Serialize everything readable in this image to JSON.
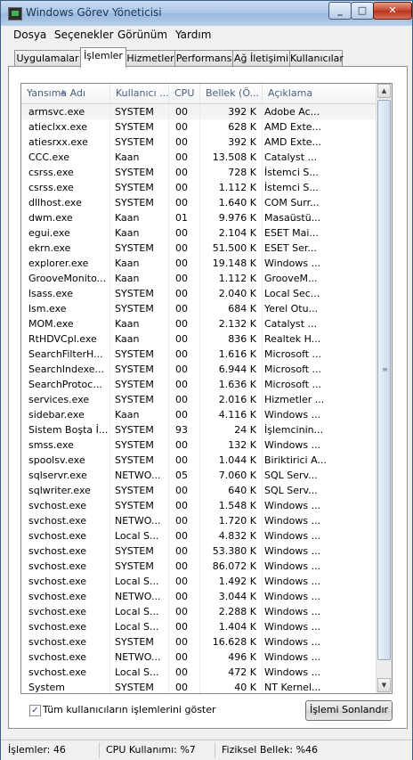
{
  "window": {
    "title": "Windows Görev Yöneticisi"
  },
  "menu": [
    "Dosya",
    "Seçenekler",
    "Görünüm",
    "Yardım"
  ],
  "tabs": [
    "Uygulamalar",
    "İşlemler",
    "Hizmetler",
    "Performans",
    "Ağ İletişimi",
    "Kullanıcılar"
  ],
  "active_tab": "İşlemler",
  "columns": [
    "Yansıma Adı",
    "Kullanıcı ...",
    "CPU",
    "Bellek (Ö...",
    "Açıklama"
  ],
  "processes": [
    [
      "armsvc.exe",
      "SYSTEM",
      "00",
      "392 K",
      "Adobe Ac..."
    ],
    [
      "atieclxx.exe",
      "SYSTEM",
      "00",
      "628 K",
      "AMD Exte..."
    ],
    [
      "atiesrxx.exe",
      "SYSTEM",
      "00",
      "392 K",
      "AMD Exte..."
    ],
    [
      "CCC.exe",
      "Kaan",
      "00",
      "13.508 K",
      "Catalyst ..."
    ],
    [
      "csrss.exe",
      "SYSTEM",
      "00",
      "728 K",
      "İstemci S..."
    ],
    [
      "csrss.exe",
      "SYSTEM",
      "00",
      "1.112 K",
      "İstemci S..."
    ],
    [
      "dllhost.exe",
      "SYSTEM",
      "00",
      "1.640 K",
      "COM Surr..."
    ],
    [
      "dwm.exe",
      "Kaan",
      "01",
      "9.976 K",
      "Masaüstü..."
    ],
    [
      "egui.exe",
      "Kaan",
      "00",
      "2.104 K",
      "ESET Mai..."
    ],
    [
      "ekrn.exe",
      "SYSTEM",
      "00",
      "51.500 K",
      "ESET Ser..."
    ],
    [
      "explorer.exe",
      "Kaan",
      "00",
      "19.148 K",
      "Windows ..."
    ],
    [
      "GrooveMonito...",
      "Kaan",
      "00",
      "1.112 K",
      "GrooveM..."
    ],
    [
      "lsass.exe",
      "SYSTEM",
      "00",
      "2.040 K",
      "Local Sec..."
    ],
    [
      "lsm.exe",
      "SYSTEM",
      "00",
      "684 K",
      "Yerel Otu..."
    ],
    [
      "MOM.exe",
      "Kaan",
      "00",
      "2.132 K",
      "Catalyst ..."
    ],
    [
      "RtHDVCpl.exe",
      "Kaan",
      "00",
      "836 K",
      "Realtek H..."
    ],
    [
      "SearchFilterH...",
      "SYSTEM",
      "00",
      "1.616 K",
      "Microsoft ..."
    ],
    [
      "SearchIndexe...",
      "SYSTEM",
      "00",
      "6.944 K",
      "Microsoft ..."
    ],
    [
      "SearchProtoc...",
      "SYSTEM",
      "00",
      "1.636 K",
      "Microsoft ..."
    ],
    [
      "services.exe",
      "SYSTEM",
      "00",
      "2.016 K",
      "Hizmetler ..."
    ],
    [
      "sidebar.exe",
      "Kaan",
      "00",
      "4.116 K",
      "Windows ..."
    ],
    [
      "Sistem Boşta İ...",
      "SYSTEM",
      "93",
      "24 K",
      "İşlemcinin..."
    ],
    [
      "smss.exe",
      "SYSTEM",
      "00",
      "132 K",
      "Windows ..."
    ],
    [
      "spoolsv.exe",
      "SYSTEM",
      "00",
      "1.044 K",
      "Biriktirici A..."
    ],
    [
      "sqlservr.exe",
      "NETWO...",
      "05",
      "7.060 K",
      "SQL Serv..."
    ],
    [
      "sqlwriter.exe",
      "SYSTEM",
      "00",
      "640 K",
      "SQL Serv..."
    ],
    [
      "svchost.exe",
      "SYSTEM",
      "00",
      "1.548 K",
      "Windows ..."
    ],
    [
      "svchost.exe",
      "NETWO...",
      "00",
      "1.720 K",
      "Windows ..."
    ],
    [
      "svchost.exe",
      "Local S...",
      "00",
      "4.832 K",
      "Windows ..."
    ],
    [
      "svchost.exe",
      "SYSTEM",
      "00",
      "53.380 K",
      "Windows ..."
    ],
    [
      "svchost.exe",
      "SYSTEM",
      "00",
      "86.072 K",
      "Windows ..."
    ],
    [
      "svchost.exe",
      "Local S...",
      "00",
      "1.492 K",
      "Windows ..."
    ],
    [
      "svchost.exe",
      "NETWO...",
      "00",
      "3.044 K",
      "Windows ..."
    ],
    [
      "svchost.exe",
      "Local S...",
      "00",
      "2.288 K",
      "Windows ..."
    ],
    [
      "svchost.exe",
      "Local S...",
      "00",
      "1.404 K",
      "Windows ..."
    ],
    [
      "svchost.exe",
      "SYSTEM",
      "00",
      "16.628 K",
      "Windows ..."
    ],
    [
      "svchost.exe",
      "NETWO...",
      "00",
      "496 K",
      "Windows ..."
    ],
    [
      "svchost.exe",
      "Local S...",
      "00",
      "472 K",
      "Windows ..."
    ],
    [
      "System",
      "SYSTEM",
      "00",
      "40 K",
      "NT Kernel..."
    ]
  ],
  "show_all_users": {
    "label": "Tüm kullanıcıların işlemlerini göster",
    "checked": true
  },
  "end_process_button": "İşlemi Sonlandır",
  "status": {
    "processes": "İşlemler: 46",
    "cpu": "CPU Kullanımı: %7",
    "memory": "Fiziksel Bellek: %46"
  }
}
